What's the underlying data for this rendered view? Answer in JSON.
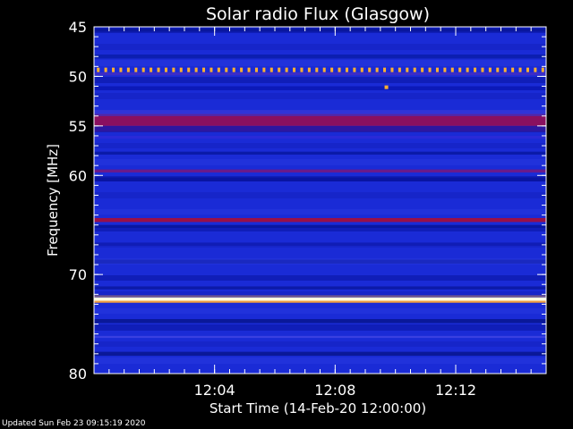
{
  "chart_data": {
    "type": "heatmap",
    "title": "Solar radio Flux (Glasgow)",
    "xlabel": "Start Time (14-Feb-20 12:00:00)",
    "ylabel": "Frequency [MHz]",
    "x_range_minutes": [
      0,
      15
    ],
    "ylim": [
      80,
      45
    ],
    "x_ticks": [
      {
        "minute": 4,
        "label": "12:04"
      },
      {
        "minute": 8,
        "label": "12:08"
      },
      {
        "minute": 12,
        "label": "12:12"
      }
    ],
    "y_ticks": [
      {
        "value": 45,
        "label": "45"
      },
      {
        "value": 50,
        "label": "50"
      },
      {
        "value": 55,
        "label": "55"
      },
      {
        "value": 60,
        "label": "60"
      },
      {
        "value": 70,
        "label": "70"
      },
      {
        "value": 80,
        "label": "80"
      }
    ],
    "background_color": "#1a2bd6",
    "bands": [
      {
        "freq_from": 45.2,
        "freq_to": 45.5,
        "color": "#0a1a9a"
      },
      {
        "freq_from": 47.8,
        "freq_to": 48.2,
        "color": "#0c1fb0"
      },
      {
        "freq_from": 49.6,
        "freq_to": 49.9,
        "color": "#3a2cc8"
      },
      {
        "freq_from": 51.0,
        "freq_to": 51.4,
        "color": "#0c1ab8"
      },
      {
        "freq_from": 53.4,
        "freq_to": 53.8,
        "color": "#3a30d0"
      },
      {
        "freq_from": 53.8,
        "freq_to": 55.0,
        "color": "#8a1060"
      },
      {
        "freq_from": 55.0,
        "freq_to": 55.6,
        "color": "#5a1aa0"
      },
      {
        "freq_from": 56.0,
        "freq_to": 56.3,
        "color": "#2a2ad8"
      },
      {
        "freq_from": 57.6,
        "freq_to": 57.9,
        "color": "#0a1aa8"
      },
      {
        "freq_from": 59.4,
        "freq_to": 59.7,
        "color": "#6a1a8a"
      },
      {
        "freq_from": 60.2,
        "freq_to": 60.6,
        "color": "#0a16a0"
      },
      {
        "freq_from": 64.3,
        "freq_to": 64.7,
        "color": "#9a1048"
      },
      {
        "freq_from": 65.0,
        "freq_to": 65.3,
        "color": "#0a1aa0"
      },
      {
        "freq_from": 66.8,
        "freq_to": 67.1,
        "color": "#0c1aa8"
      },
      {
        "freq_from": 68.5,
        "freq_to": 68.9,
        "color": "#0a1898"
      },
      {
        "freq_from": 71.2,
        "freq_to": 71.5,
        "color": "#0c1aa8"
      },
      {
        "freq_from": 72.1,
        "freq_to": 72.3,
        "color": "#f0a040"
      },
      {
        "freq_from": 72.3,
        "freq_to": 72.65,
        "color": "#ffffe0"
      },
      {
        "freq_from": 72.65,
        "freq_to": 72.85,
        "color": "#f0a040"
      },
      {
        "freq_from": 74.5,
        "freq_to": 74.9,
        "color": "#0a1898"
      },
      {
        "freq_from": 76.2,
        "freq_to": 76.4,
        "color": "#3a40e0"
      },
      {
        "freq_from": 77.8,
        "freq_to": 78.2,
        "color": "#0a1898"
      }
    ],
    "dotted_line": {
      "freq": 49.3,
      "color": "#ffb030",
      "count": 60
    },
    "isolated_points": [
      {
        "minute": 9.7,
        "freq": 51.1,
        "color": "#ffb030"
      }
    ]
  },
  "footer": {
    "updated_text": "Updated Sun Feb 23 09:15:19 2020"
  }
}
